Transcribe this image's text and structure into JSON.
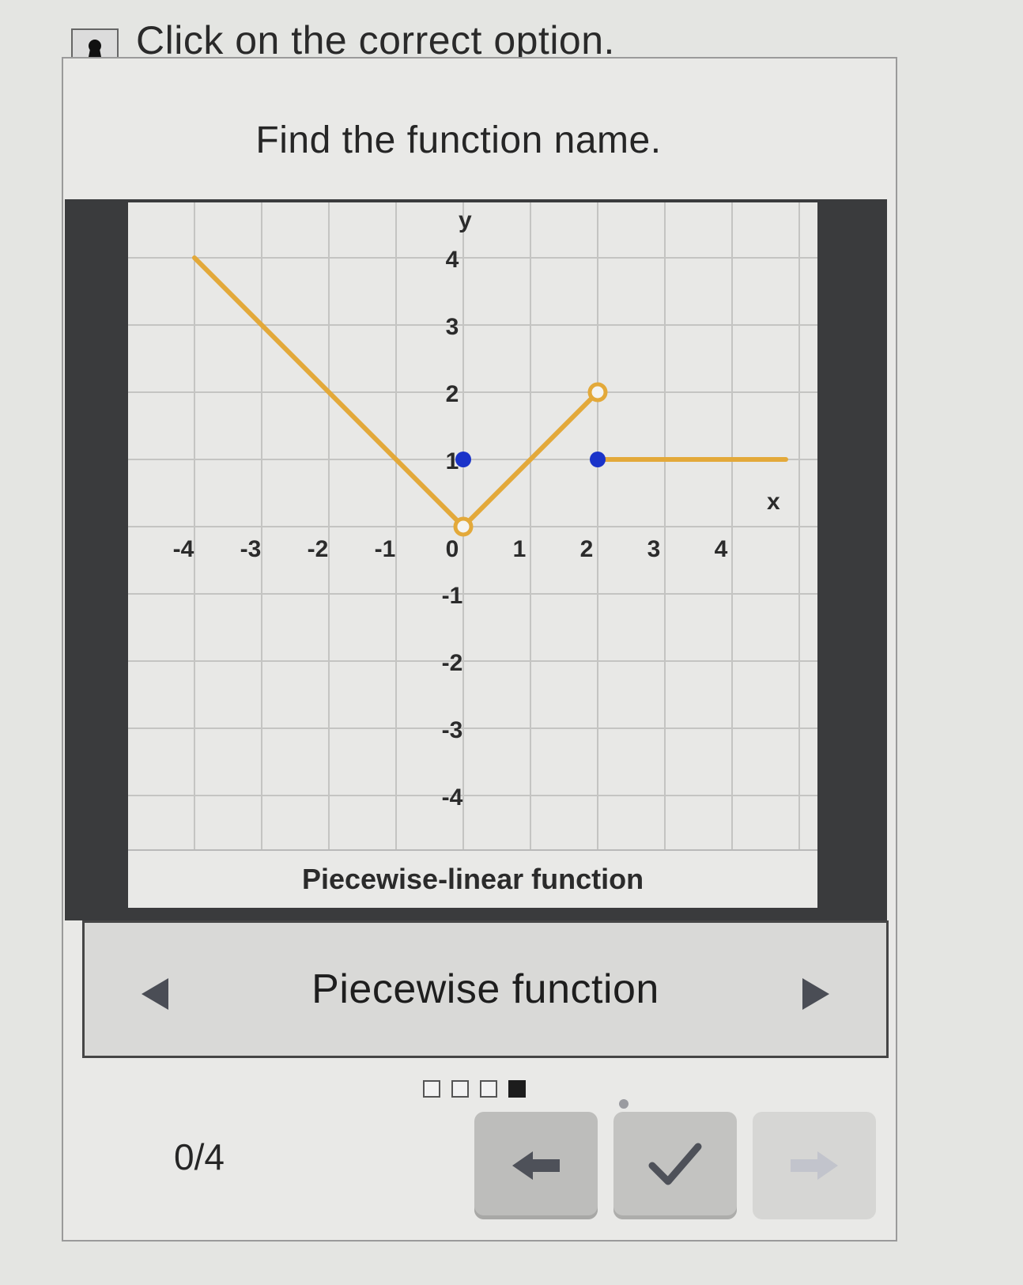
{
  "instruction": {
    "text": "Click on the correct option.",
    "icon": "instruction-icon"
  },
  "question": {
    "text": "Find the function name."
  },
  "chart_data": {
    "type": "line",
    "xlabel": "x",
    "ylabel": "y",
    "xlim": [
      -4,
      4
    ],
    "ylim": [
      -4,
      4
    ],
    "grid": true,
    "x_ticks": [
      "-4",
      "-3",
      "-2",
      "-1",
      "0",
      "1",
      "2",
      "3",
      "4"
    ],
    "y_ticks": [
      "4",
      "3",
      "2",
      "1",
      "-1",
      "-2",
      "-3",
      "-4"
    ],
    "line_color": "#e3a93a",
    "segments": [
      {
        "points": [
          [
            -4,
            4
          ],
          [
            0,
            0
          ]
        ]
      },
      {
        "points": [
          [
            0,
            0
          ],
          [
            2,
            2
          ]
        ]
      },
      {
        "points": [
          [
            2,
            1
          ],
          [
            4.8,
            1
          ]
        ]
      }
    ],
    "open_points": [
      [
        0,
        0
      ],
      [
        2,
        2
      ]
    ],
    "closed_points": [
      [
        0,
        1
      ],
      [
        2,
        1
      ]
    ],
    "closed_point_color": "#1a33c9"
  },
  "graph": {
    "caption": "Piecewise-linear function"
  },
  "selector": {
    "option_label": "Piecewise function",
    "prev_icon": "triangle-left-icon",
    "next_icon": "triangle-right-icon"
  },
  "progress": {
    "score": "0/4",
    "pages_total": 4,
    "current_page": 4
  },
  "buttons": {
    "back_icon": "arrow-left-icon",
    "check_icon": "checkmark-icon",
    "next_icon": "arrow-right-icon"
  }
}
